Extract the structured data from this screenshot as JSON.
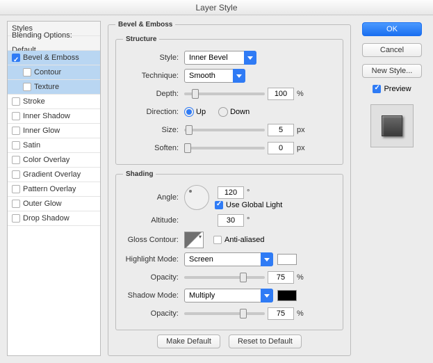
{
  "window_title": "Layer Style",
  "left": {
    "styles_header": "Styles",
    "blending_header": "Blending Options: Default",
    "effects": [
      {
        "label": "Bevel & Emboss",
        "checked": true,
        "selected": true
      },
      {
        "label": "Contour",
        "checked": false,
        "selected": true,
        "indent": true
      },
      {
        "label": "Texture",
        "checked": false,
        "selected": true,
        "indent": true
      },
      {
        "label": "Stroke",
        "checked": false
      },
      {
        "label": "Inner Shadow",
        "checked": false
      },
      {
        "label": "Inner Glow",
        "checked": false
      },
      {
        "label": "Satin",
        "checked": false
      },
      {
        "label": "Color Overlay",
        "checked": false
      },
      {
        "label": "Gradient Overlay",
        "checked": false
      },
      {
        "label": "Pattern Overlay",
        "checked": false
      },
      {
        "label": "Outer Glow",
        "checked": false
      },
      {
        "label": "Drop Shadow",
        "checked": false
      }
    ]
  },
  "panel_title": "Bevel & Emboss",
  "structure": {
    "legend": "Structure",
    "style_label": "Style:",
    "style_value": "Inner Bevel",
    "technique_label": "Technique:",
    "technique_value": "Smooth",
    "depth_label": "Depth:",
    "depth_value": "100",
    "depth_unit": "%",
    "direction_label": "Direction:",
    "up_label": "Up",
    "down_label": "Down",
    "size_label": "Size:",
    "size_value": "5",
    "size_unit": "px",
    "soften_label": "Soften:",
    "soften_value": "0",
    "soften_unit": "px"
  },
  "shading": {
    "legend": "Shading",
    "angle_label": "Angle:",
    "angle_value": "120",
    "angle_unit": "°",
    "global_light_label": "Use Global Light",
    "altitude_label": "Altitude:",
    "altitude_value": "30",
    "altitude_unit": "°",
    "gloss_label": "Gloss Contour:",
    "anti_alias_label": "Anti-aliased",
    "highlight_mode_label": "Highlight Mode:",
    "highlight_mode_value": "Screen",
    "highlight_color": "#ffffff",
    "hl_opacity_label": "Opacity:",
    "hl_opacity_value": "75",
    "hl_opacity_unit": "%",
    "shadow_mode_label": "Shadow Mode:",
    "shadow_mode_value": "Multiply",
    "shadow_color": "#000000",
    "sh_opacity_label": "Opacity:",
    "sh_opacity_value": "75",
    "sh_opacity_unit": "%"
  },
  "buttons": {
    "make_default": "Make Default",
    "reset_default": "Reset to Default",
    "ok": "OK",
    "cancel": "Cancel",
    "new_style": "New Style...",
    "preview": "Preview"
  }
}
